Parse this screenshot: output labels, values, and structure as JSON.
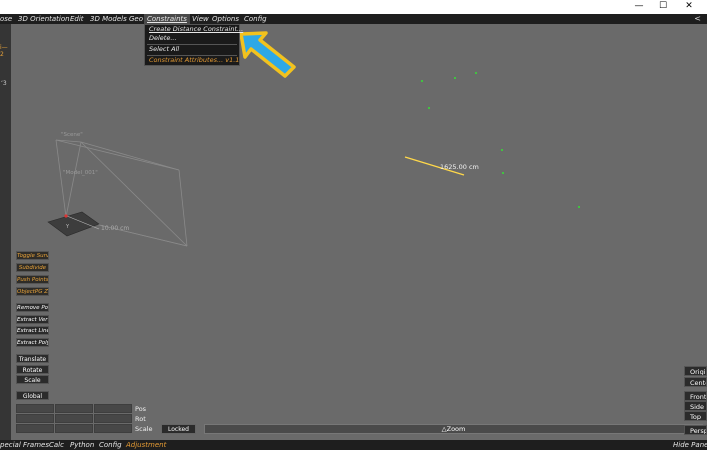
{
  "window": {
    "minimize": "—",
    "maximize": "☐",
    "close": "✕"
  },
  "menubar": {
    "items": [
      "ose",
      "3D Orientation",
      "Edit",
      "3D Models",
      "Geo",
      "Constraints",
      "View",
      "Options",
      "Config"
    ],
    "right_label": "<"
  },
  "left_strip": {
    "mark1": "i—2",
    "mark2": "ʻ3"
  },
  "constraints_menu": {
    "items": [
      "Create Distance Constraint...",
      "Delete...",
      "Select All",
      "Constraint Attributes...  v1.1"
    ]
  },
  "viewport": {
    "scene_label": "\"Scene\"",
    "model_label": "\"Model_001\"",
    "ground_label": "10.00 cm",
    "constraint_label": "1625.00 cm",
    "accent_color": "#ffd84a",
    "arrow_fill": "#2ea8e6",
    "arrow_outline": "#f2c21e",
    "point_color": "#35e035"
  },
  "left_panel": {
    "orange_buttons": [
      "Toggle Survey",
      "Subdivide",
      "Push Points",
      "ObjectPG Z"
    ],
    "tool_buttons": [
      "Remove Poly",
      "Extract Vertex",
      "Extract Line",
      "Extract Polygon"
    ],
    "transform_buttons": [
      "Translate",
      "Rotate",
      "Scale"
    ],
    "global_button": "Global",
    "row_labels": [
      "Pos",
      "Rot",
      "Scale"
    ]
  },
  "bottom": {
    "locked_label": "Locked",
    "zoom_label": "△Zoom",
    "menu_items": [
      "pecial Frames",
      "Calc",
      "Python",
      "Config",
      "Adjustment"
    ],
    "hide_panes": "Hide Panes"
  },
  "right_panel": {
    "buttons": [
      "Origin",
      "Center",
      "Front",
      "Side",
      "Top",
      "Persp"
    ]
  }
}
